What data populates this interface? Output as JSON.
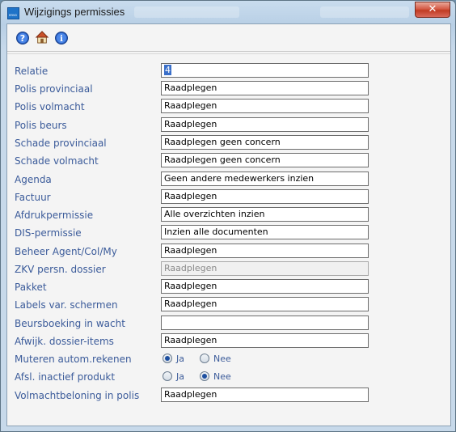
{
  "window": {
    "title": "Wijzigings permissies",
    "app_icon_text": "envo",
    "close_label": "✕"
  },
  "toolbar": {
    "icons": [
      "help-icon",
      "home-icon",
      "info-icon"
    ]
  },
  "colors": {
    "label": "#3b5b9a",
    "titlebar": "#b8cfe5",
    "close": "#c03a22",
    "selection": "#3a6fc9"
  },
  "form": {
    "fields": [
      {
        "label": "Relatie",
        "value": "4"
      },
      {
        "label": "Polis provinciaal",
        "value": "Raadplegen"
      },
      {
        "label": "Polis volmacht",
        "value": "Raadplegen"
      },
      {
        "label": "Polis beurs",
        "value": "Raadplegen"
      },
      {
        "label": "Schade provinciaal",
        "value": "Raadplegen geen concern"
      },
      {
        "label": "Schade volmacht",
        "value": "Raadplegen geen concern"
      },
      {
        "label": "Agenda",
        "value": "Geen andere medewerkers inzien"
      },
      {
        "label": "Factuur",
        "value": "Raadplegen"
      },
      {
        "label": "Afdrukpermissie",
        "value": "Alle overzichten inzien"
      },
      {
        "label": "DIS-permissie",
        "value": "Inzien alle documenten"
      },
      {
        "label": "Beheer Agent/Col/My",
        "value": "Raadplegen"
      },
      {
        "label": "ZKV persn. dossier",
        "value": "Raadplegen"
      },
      {
        "label": "Pakket",
        "value": "Raadplegen"
      },
      {
        "label": "Labels var. schermen",
        "value": "Raadplegen"
      },
      {
        "label": "Beursboeking in wacht",
        "value": ""
      },
      {
        "label": "Afwijk. dossier-items",
        "value": "Raadplegen"
      }
    ],
    "muteren": {
      "label": "Muteren autom.rekenen",
      "options": [
        "Ja",
        "Nee"
      ],
      "selected": "Ja"
    },
    "afsl": {
      "label": "Afsl. inactief produkt",
      "options": [
        "Ja",
        "Nee"
      ],
      "selected": "Nee"
    },
    "volmacht": {
      "label": "Volmachtbeloning in polis",
      "value": "Raadplegen"
    }
  }
}
